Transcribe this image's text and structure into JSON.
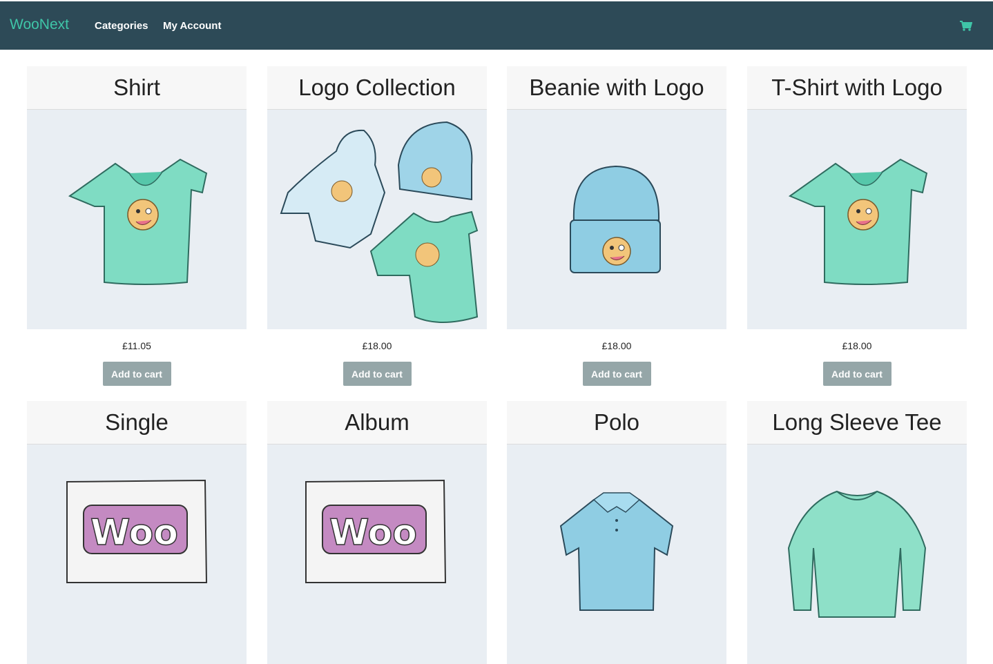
{
  "header": {
    "brand": "WooNext",
    "nav": [
      {
        "label": "Categories"
      },
      {
        "label": "My Account"
      }
    ],
    "cart_icon": "shopping-cart-icon",
    "colors": {
      "bar": "#2d4a57",
      "brand": "#3fc6a8"
    }
  },
  "products": [
    {
      "title": "Shirt",
      "price": "£11.05",
      "button": "Add to cart",
      "image": "tshirt-emoji-image"
    },
    {
      "title": "Logo Collection",
      "price": "£18.00",
      "button": "Add to cart",
      "image": "hoodie-beanie-tshirt-image"
    },
    {
      "title": "Beanie with Logo",
      "price": "£18.00",
      "button": "Add to cart",
      "image": "beanie-emoji-image"
    },
    {
      "title": "T-Shirt with Logo",
      "price": "£18.00",
      "button": "Add to cart",
      "image": "tshirt-emoji-image"
    },
    {
      "title": "Single",
      "image": "woo-single-image"
    },
    {
      "title": "Album",
      "image": "woo-album-image"
    },
    {
      "title": "Polo",
      "image": "polo-shirt-image"
    },
    {
      "title": "Long Sleeve Tee",
      "image": "long-sleeve-tee-image"
    }
  ]
}
